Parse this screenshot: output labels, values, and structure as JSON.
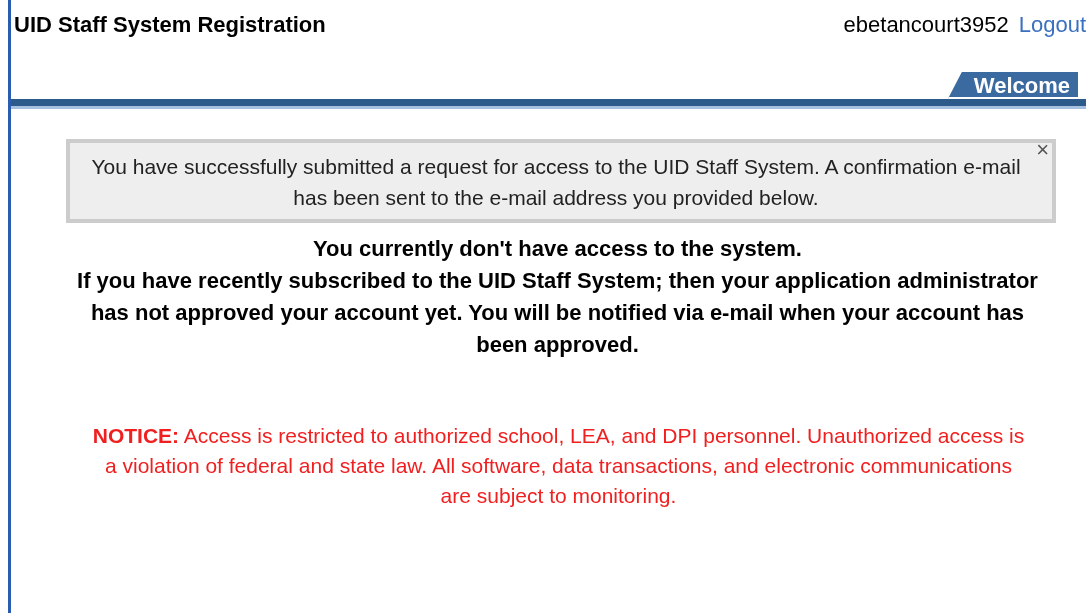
{
  "header": {
    "title": "UID Staff System Registration",
    "username": "ebetancourt3952",
    "logout": "Logout"
  },
  "tabs": [
    {
      "label": "Welcome",
      "selected": true
    }
  ],
  "alert": {
    "message": "You have successfully submitted a request for access to the UID Staff System. A confirmation e-mail has been sent to the e-mail address you provided below.",
    "close": "×"
  },
  "access_message": [
    "You currently don't have access to the system.",
    "If you have recently subscribed to the UID Staff System; then your application administrator",
    "has not approved your account yet.  You will be notified via e-mail when your account has been approved."
  ],
  "notice": "**NOTICE:** Access is restricted to authorized school, LEA, and DPI personnel. Unauthorized access is a violation of federal and state law. All software, data transactions, and electronic communications are subject to monitoring."
}
